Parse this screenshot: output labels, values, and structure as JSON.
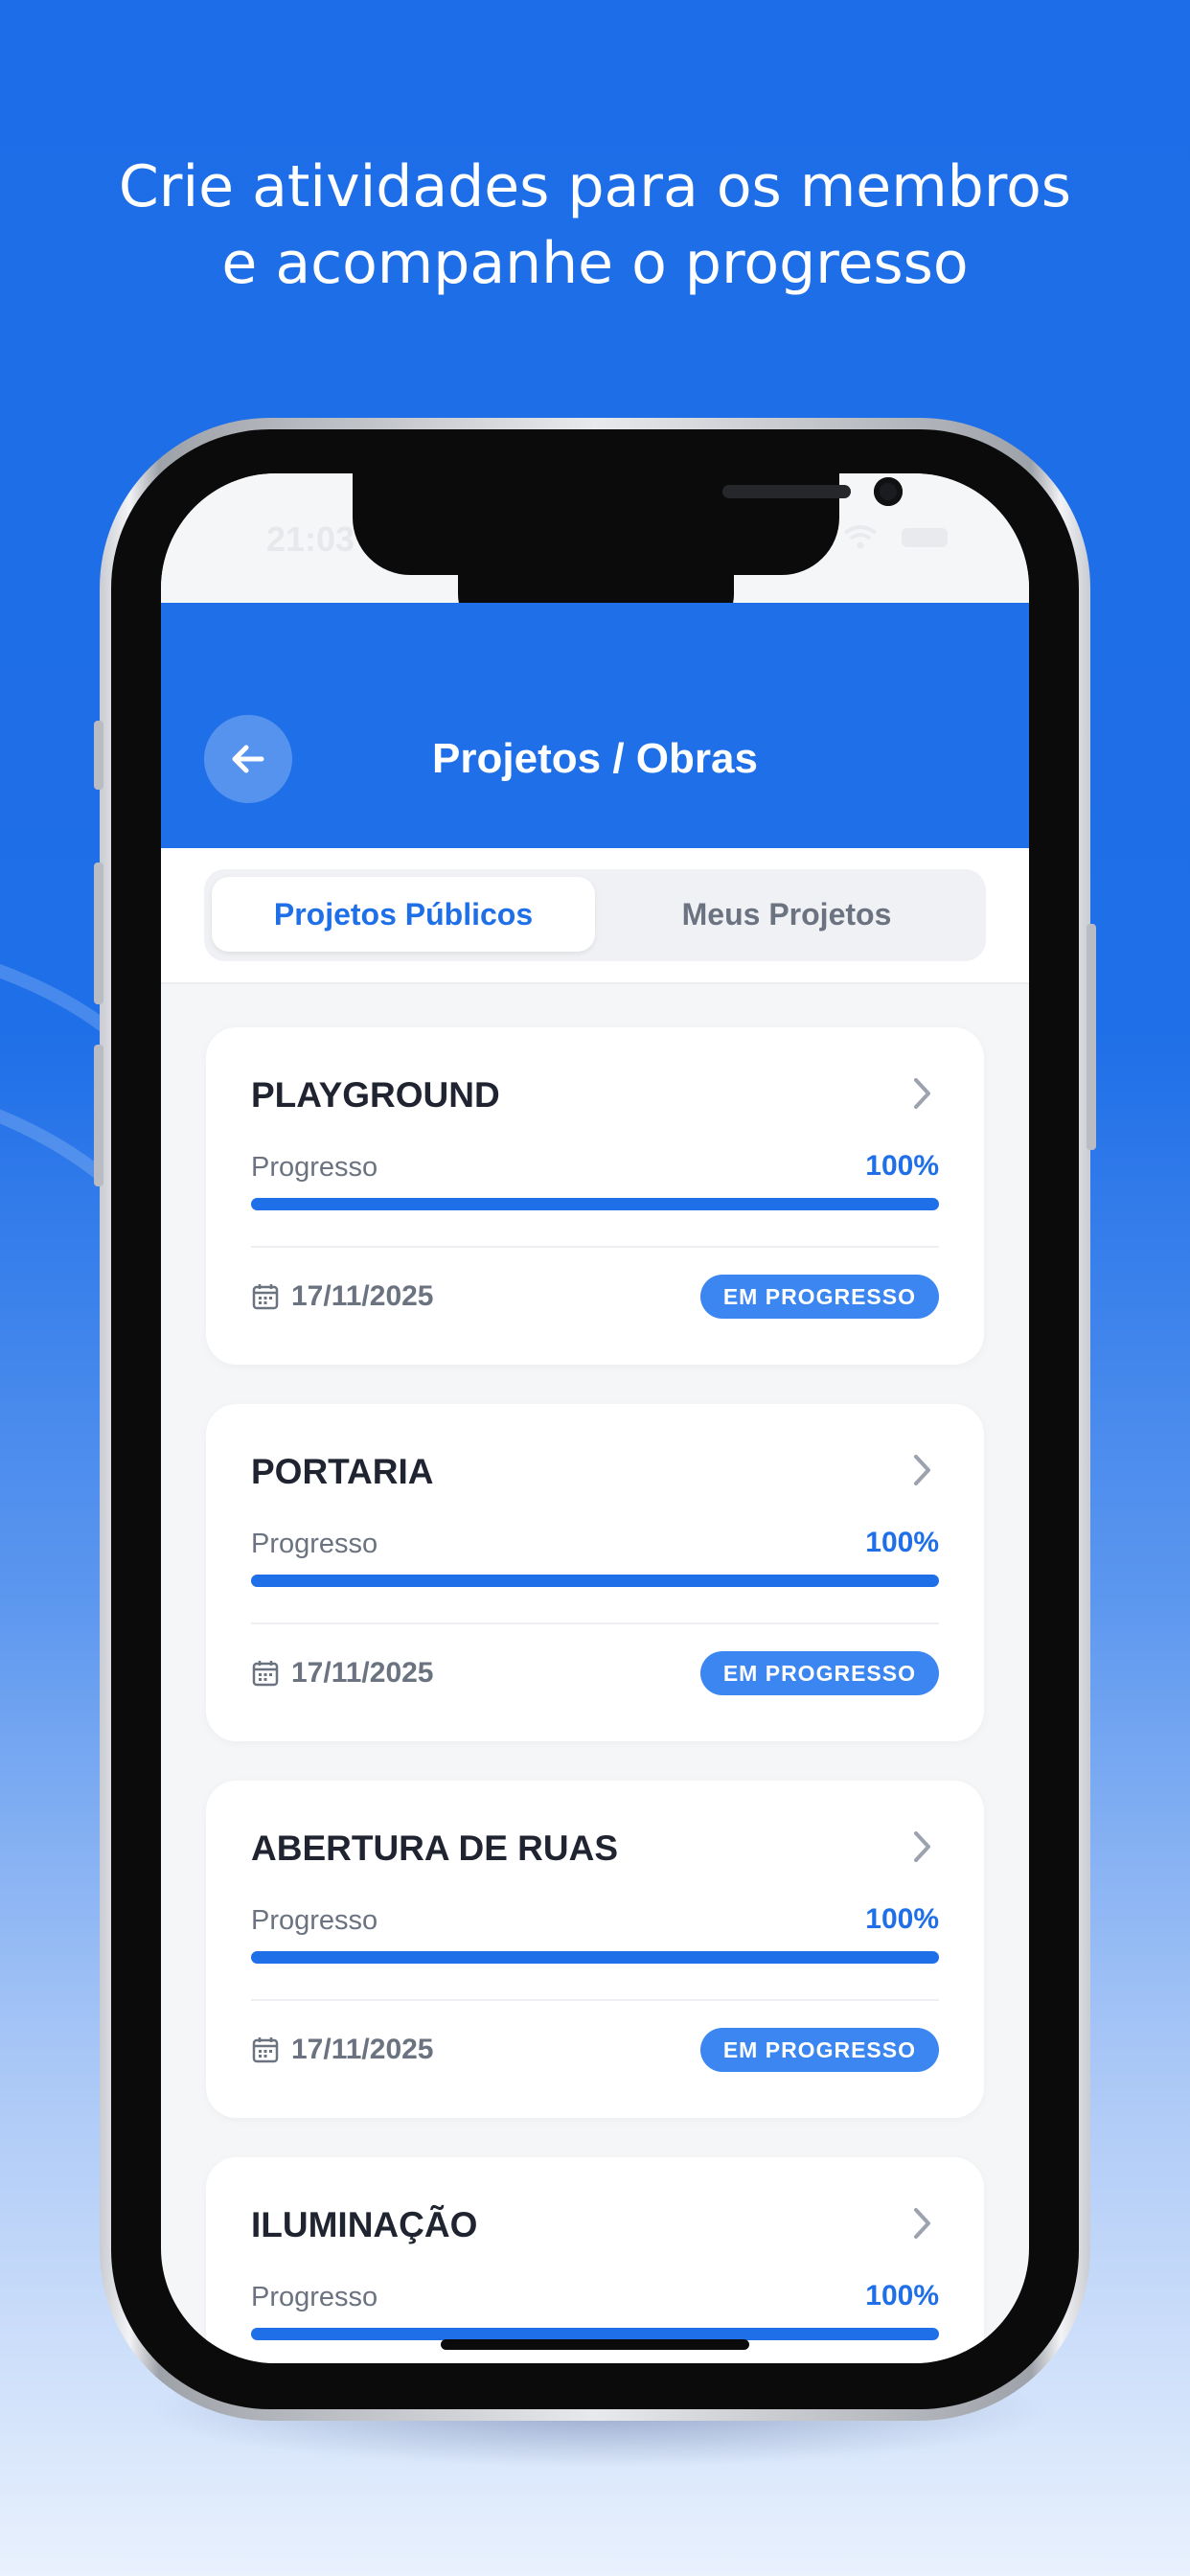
{
  "headline": {
    "line1": "Crie atividades para os membros",
    "line2": "e acompanhe o progresso"
  },
  "status_bar": {
    "time": "21:03"
  },
  "header": {
    "title": "Projetos / Obras",
    "back_icon": "arrow-left-icon"
  },
  "tabs": [
    {
      "label": "Projetos Públicos",
      "active": true
    },
    {
      "label": "Meus Projetos",
      "active": false
    }
  ],
  "projects": [
    {
      "title": "PLAYGROUND",
      "progress_label": "Progresso",
      "progress_text": "100%",
      "progress": 1.0,
      "date": "17/11/2025",
      "status": "EM PROGRESSO"
    },
    {
      "title": "PORTARIA",
      "progress_label": "Progresso",
      "progress_text": "100%",
      "progress": 1.0,
      "date": "17/11/2025",
      "status": "EM PROGRESSO"
    },
    {
      "title": "ABERTURA DE RUAS",
      "progress_label": "Progresso",
      "progress_text": "100%",
      "progress": 1.0,
      "date": "17/11/2025",
      "status": "EM PROGRESSO"
    },
    {
      "title": "ILUMINAÇÃO",
      "progress_label": "Progresso",
      "progress_text": "100%",
      "progress": 1.0,
      "date": "",
      "status": ""
    }
  ],
  "colors": {
    "brand": "#1E6FE8",
    "badge": "#3B86F0",
    "title_text": "#1F2430",
    "muted_text": "#6B7280"
  }
}
